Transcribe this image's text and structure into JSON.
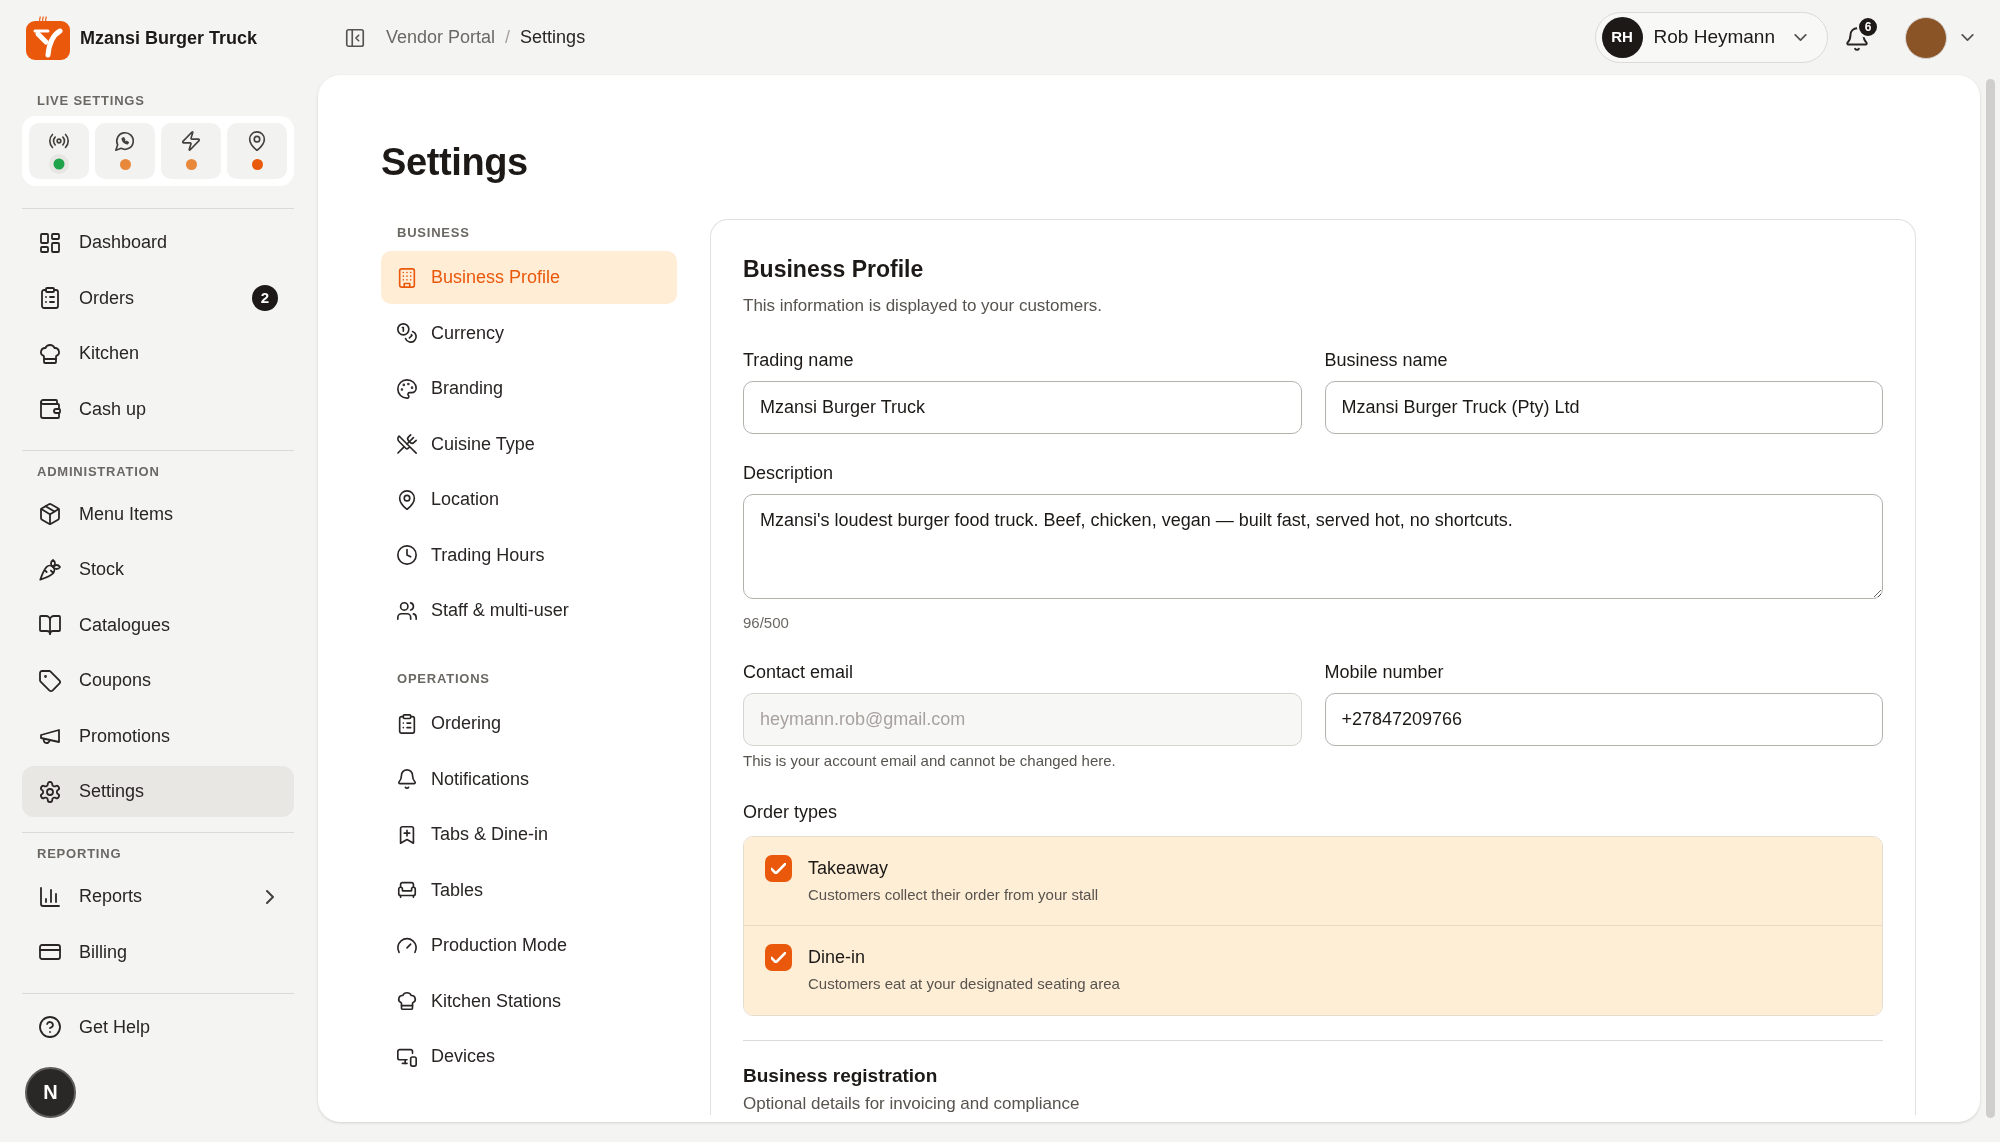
{
  "sidebar": {
    "brand": {
      "name": "Mzansi Burger Truck"
    },
    "live_settings": {
      "title": "LIVE SETTINGS",
      "toggles": [
        {
          "color": "#1fa34a",
          "pulse": true
        },
        {
          "color": "#e8883a",
          "pulse": false
        },
        {
          "color": "#e8883a",
          "pulse": false
        },
        {
          "color": "#e8590c",
          "pulse": false
        }
      ]
    },
    "sections": [
      {
        "items": [
          {
            "label": "Dashboard",
            "kind": "link",
            "selected": false
          },
          {
            "label": "Orders",
            "kind": "link",
            "selected": false,
            "badge": "2"
          },
          {
            "label": "Kitchen",
            "kind": "link",
            "selected": false
          },
          {
            "label": "Cash up",
            "kind": "link",
            "selected": false
          }
        ]
      },
      {
        "title": "ADMINISTRATION",
        "items": [
          {
            "label": "Menu Items",
            "kind": "link",
            "selected": false
          },
          {
            "label": "Stock",
            "kind": "link",
            "selected": false
          },
          {
            "label": "Catalogues",
            "kind": "link",
            "selected": false
          },
          {
            "label": "Coupons",
            "kind": "link",
            "selected": false
          },
          {
            "label": "Promotions",
            "kind": "link",
            "selected": false
          },
          {
            "label": "Settings",
            "kind": "link",
            "selected": true
          }
        ]
      },
      {
        "title": "REPORTING",
        "items": [
          {
            "label": "Reports",
            "kind": "group",
            "selected": false
          },
          {
            "label": "Billing",
            "kind": "link",
            "selected": false
          }
        ]
      },
      {
        "items": [
          {
            "label": "Get Help",
            "kind": "link",
            "selected": false
          }
        ]
      }
    ],
    "dev_tools_button": {
      "label": "N"
    }
  },
  "top_bar": {
    "breadcrumb": {
      "separator": "/",
      "items": [
        {
          "label": "Vendor Portal",
          "current": false
        },
        {
          "label": "Settings",
          "current": true
        }
      ]
    },
    "user_menu": {
      "initials": "RH",
      "name": "Rob Heymann"
    },
    "notifications": {
      "count": "6"
    }
  },
  "page": {
    "title": "Settings",
    "settings_nav": {
      "sections": [
        {
          "title": "BUSINESS",
          "items": [
            {
              "label": "Business Profile",
              "selected": true
            },
            {
              "label": "Currency",
              "selected": false
            },
            {
              "label": "Branding",
              "selected": false
            },
            {
              "label": "Cuisine Type",
              "selected": false
            },
            {
              "label": "Location",
              "selected": false
            },
            {
              "label": "Trading Hours",
              "selected": false
            },
            {
              "label": "Staff & multi-user",
              "selected": false
            }
          ]
        },
        {
          "title": "OPERATIONS",
          "items": [
            {
              "label": "Ordering",
              "selected": false
            },
            {
              "label": "Notifications",
              "selected": false
            },
            {
              "label": "Tabs & Dine-in",
              "selected": false
            },
            {
              "label": "Tables",
              "selected": false
            },
            {
              "label": "Production Mode",
              "selected": false
            },
            {
              "label": "Kitchen Stations",
              "selected": false
            },
            {
              "label": "Devices",
              "selected": false
            }
          ]
        }
      ]
    },
    "business_profile": {
      "title": "Business Profile",
      "subtitle": "This information is displayed to your customers.",
      "fields": [
        {
          "kind": "text",
          "label": "Trading name",
          "value": "Mzansi Burger Truck",
          "disabled": false
        },
        {
          "kind": "text",
          "label": "Business name",
          "value": "Mzansi Burger Truck (Pty) Ltd",
          "disabled": false
        },
        {
          "kind": "textarea",
          "label": "Description",
          "value": "Mzansi's loudest burger food truck. Beef, chicken, vegan — built fast, served hot, no shortcuts.",
          "disabled": false,
          "counter": "96/500"
        },
        {
          "kind": "text",
          "label": "Contact email",
          "value": "heymann.rob@gmail.com",
          "disabled": true,
          "help": "This is your account email and cannot be changed here."
        },
        {
          "kind": "text",
          "label": "Mobile number",
          "value": "+27847209766",
          "disabled": false
        }
      ],
      "order_types": {
        "label": "Order types",
        "options": [
          {
            "title": "Takeaway",
            "description": "Customers collect their order from your stall",
            "checked": true
          },
          {
            "title": "Dine-in",
            "description": "Customers eat at your designated seating area",
            "checked": true
          }
        ]
      },
      "registration": {
        "title": "Business registration",
        "subtitle": "Optional details for invoicing and compliance"
      }
    }
  }
}
